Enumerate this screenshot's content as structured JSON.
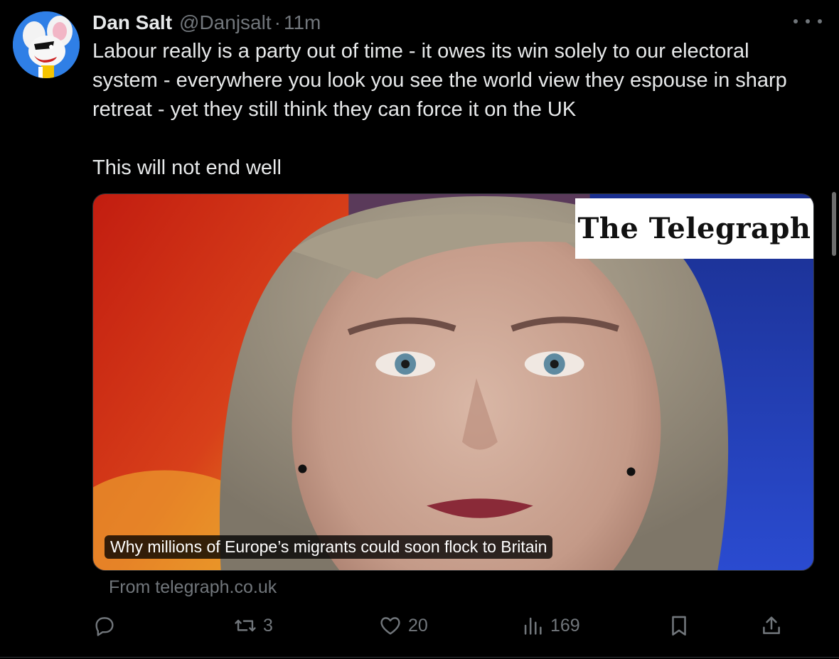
{
  "post": {
    "author": {
      "display_name": "Dan Salt",
      "handle": "@Danjsalt",
      "separator": "·",
      "time": "11m",
      "avatar_icon": "cartoon-mouse-avatar-icon"
    },
    "text_lines": [
      "Labour really is a party out of time - it owes its win solely to our electoral",
      "system - everywhere you look you see the world view they espouse in sharp",
      "retreat - yet they still think they can force it on the UK"
    ],
    "text_last": "This will not end well",
    "card": {
      "brand": "The Telegraph",
      "headline": "Why millions of Europe’s migrants could soon flock to Britain",
      "source": "From telegraph.co.uk"
    },
    "actions": {
      "reply": {
        "icon": "reply-icon",
        "count": ""
      },
      "repost": {
        "icon": "repost-icon",
        "count": "3"
      },
      "like": {
        "icon": "heart-icon",
        "count": "20"
      },
      "views": {
        "icon": "views-bar-icon",
        "count": "169"
      },
      "bookmark": {
        "icon": "bookmark-icon"
      },
      "share": {
        "icon": "share-icon"
      }
    }
  },
  "colors": {
    "background": "#000000",
    "text": "#e7e9ea",
    "muted": "#71767b",
    "avatar_bg": "#2f7fe6"
  }
}
